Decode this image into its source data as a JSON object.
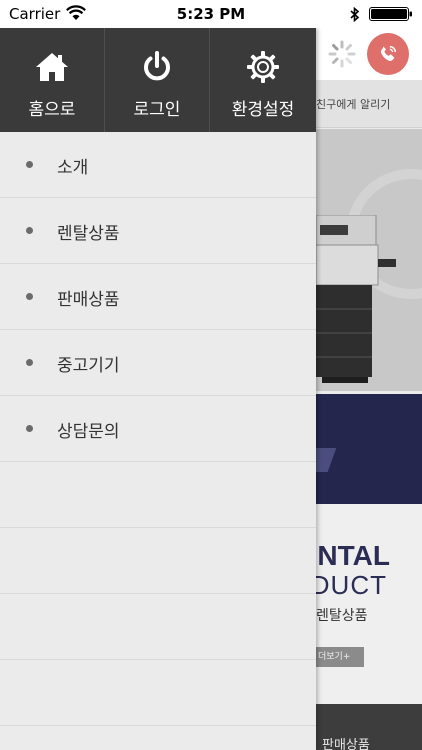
{
  "status_bar": {
    "carrier": "Carrier",
    "time": "5:23 PM"
  },
  "background_app": {
    "link_text": "친구에게 알리기",
    "rental_title": "NTAL",
    "rental_subtitle": "RODUCT",
    "rental_korean": "렌탈상품",
    "more_label": "더보기+",
    "footer_text": "판매상품",
    "colors": {
      "call_button": "#de6f6a",
      "dark_band": "#24264e"
    }
  },
  "drawer": {
    "top_buttons": [
      {
        "label": "홈으로",
        "icon": "home-icon"
      },
      {
        "label": "로그인",
        "icon": "power-icon"
      },
      {
        "label": "환경설정",
        "icon": "gear-icon"
      }
    ],
    "menu": [
      {
        "label": "소개"
      },
      {
        "label": "렌탈상품"
      },
      {
        "label": "판매상품"
      },
      {
        "label": "중고기기"
      },
      {
        "label": "상담문의"
      }
    ],
    "colors": {
      "header_bg": "#3a3a3a",
      "menu_bg": "#ebebeb"
    }
  }
}
